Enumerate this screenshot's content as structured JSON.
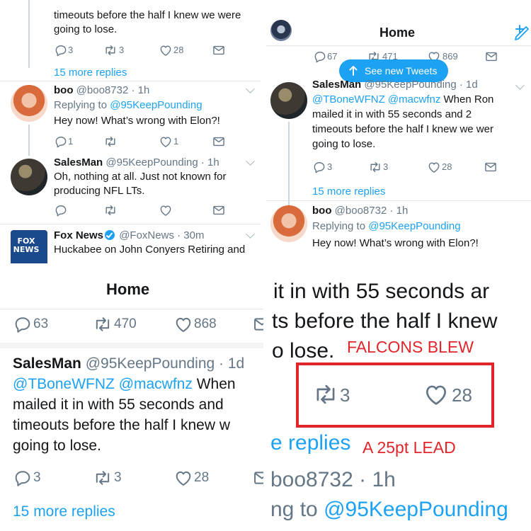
{
  "tl": {
    "frag_line1": "timeouts before the half I knew we were",
    "frag_line2": "going to lose.",
    "actions1": {
      "reply": "3",
      "retweet": "3",
      "like": "28"
    },
    "more_replies": "15 more replies",
    "boo": {
      "name": "boo",
      "handle": "@boo8732",
      "time": "· 1h",
      "replying_prefix": "Replying to",
      "replying_to": "@95KeepPounding",
      "text": "Hey now! What’s wrong with Elon?!",
      "reply": "1",
      "like": "1"
    },
    "sales": {
      "name": "SalesMan",
      "handle": "@95KeepPounding",
      "time": "· 1h",
      "line1": "Oh, nothing at all. Just not known for",
      "line2": "producing NFL LTs."
    },
    "fox": {
      "name": "Fox News",
      "handle": "@FoxNews",
      "time": "· 30m",
      "logo": "FOX NEWS",
      "line1": "Huckabee on John Conyers Retiring and"
    }
  },
  "tr": {
    "title": "Home",
    "actions_top": {
      "reply": "67",
      "retweet": "471",
      "like": "869"
    },
    "pill": "See new Tweets",
    "sales": {
      "name": "SalesMan",
      "handle": "@95KeepPounding",
      "time": "· 1d",
      "mention1": "@TBoneWFNZ",
      "mention2": "@macwfnz",
      "line1_rest": "When Ron",
      "line2": "mailed it in with 55 seconds and 2",
      "line3": "timeouts before the half I knew we wer",
      "line4": "going to lose."
    },
    "actions2": {
      "reply": "3",
      "retweet": "3",
      "like": "28"
    },
    "more_replies": "15 more replies",
    "boo": {
      "name": "boo",
      "handle": "@boo8732",
      "time": "· 1h",
      "replying_prefix": "Replying to",
      "replying_to": "@95KeepPounding",
      "text": "Hey now! What’s wrong with Elon?!"
    }
  },
  "bl": {
    "title": "Home",
    "actions_top": {
      "reply": "63",
      "retweet": "470",
      "like": "868"
    },
    "sales": {
      "name": "SalesMan",
      "handle": "@95KeepPounding",
      "time": "· 1d",
      "mention1": "@TBoneWFNZ",
      "mention2": "@macwfnz",
      "line1_rest": "When",
      "line2": "mailed it in with 55 seconds and",
      "line3": "timeouts before the half I knew w",
      "line4": "going to lose."
    },
    "actions2": {
      "reply": "3",
      "retweet": "3",
      "like": "28"
    },
    "more_replies": "15 more replies"
  },
  "br": {
    "line1": "it in with 55 seconds ar",
    "line2": "ts before the half I knew",
    "line3": "o lose.",
    "annot1": "FALCONS BLEW",
    "retweet": "3",
    "like": "28",
    "more_replies": "e replies",
    "annot2": "A 25pt LEAD",
    "handle_frag": "boo8732 · 1h",
    "replying_frag_prefix": "ng to",
    "replying_frag": "@95KeepPounding"
  },
  "colors": {
    "accent": "#1da1f2",
    "annotation": "#e0262b",
    "text": "#14171a",
    "muted": "#657786"
  },
  "icons": [
    "reply-icon",
    "retweet-icon",
    "like-icon",
    "message-icon",
    "chevron-down-icon",
    "compose-icon",
    "arrow-up-icon",
    "verified-icon"
  ]
}
